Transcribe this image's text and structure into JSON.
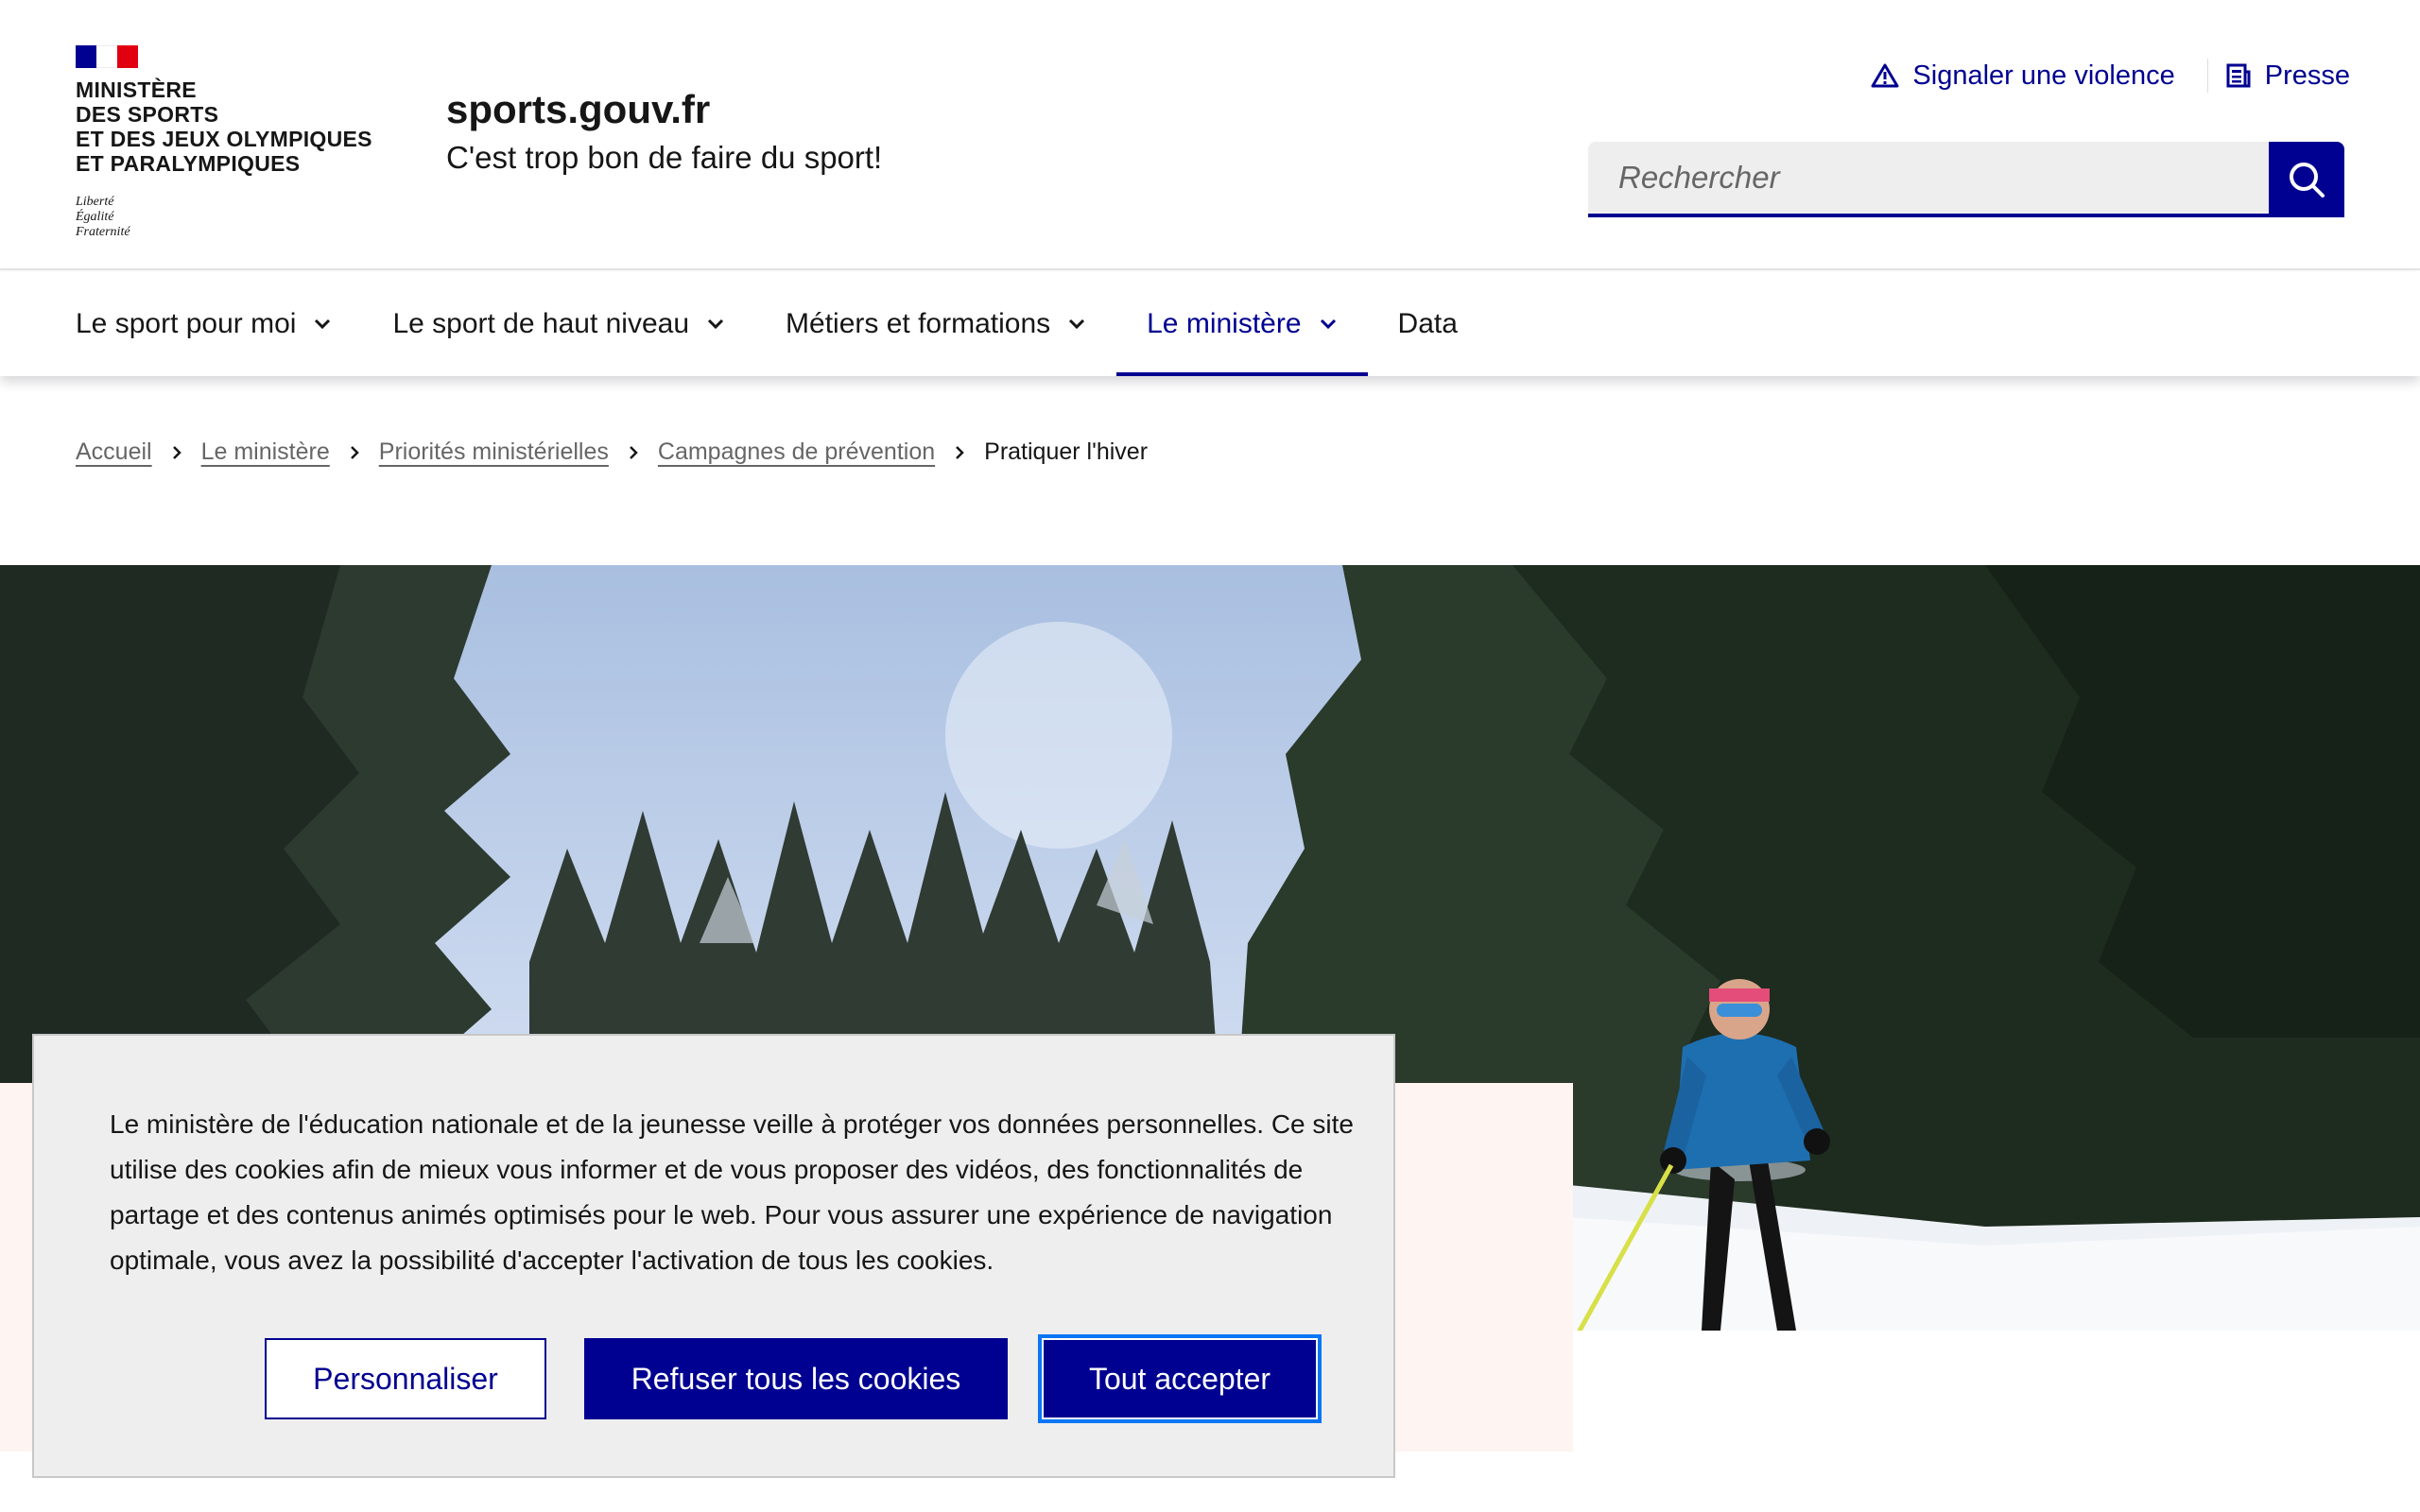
{
  "header": {
    "ministry_lines": [
      "Ministère",
      "des Sports",
      "et des Jeux Olympiques",
      "et Paralympiques"
    ],
    "motto_lines": [
      "Liberté",
      "Égalité",
      "Fraternité"
    ],
    "site_title": "sports.gouv.fr",
    "tagline": "C'est trop bon de faire du sport!",
    "tools": {
      "report_label": "Signaler une violence",
      "press_label": "Presse"
    },
    "search": {
      "placeholder": "Rechercher"
    }
  },
  "nav": {
    "items": [
      {
        "label": "Le sport pour moi"
      },
      {
        "label": "Le sport de haut niveau"
      },
      {
        "label": "Métiers et formations"
      },
      {
        "label": "Le ministère"
      },
      {
        "label": "Data"
      }
    ]
  },
  "breadcrumb": {
    "items": [
      "Accueil",
      "Le ministère",
      "Priorités ministérielles",
      "Campagnes de prévention"
    ],
    "current": "Pratiquer l'hiver"
  },
  "cookie": {
    "text": "Le ministère de l'éducation nationale et de la jeunesse veille à protéger vos données personnelles. Ce site utilise des cookies afin de mieux vous informer et de vous proposer des vidéos, des fonctionnalités de partage et des contenus animés optimisés pour le web. Pour vous assurer une expérience de navigation optimale, vous avez la possibilité d'accepter l'activation de tous les cookies.",
    "customize_label": "Personnaliser",
    "refuse_label": "Refuser tous les cookies",
    "accept_label": "Tout accepter"
  },
  "colors": {
    "primary": "#000091",
    "pink_panel": "#fef4f2",
    "cookie_bg": "#eeeeee",
    "focus_ring": "#0a76f6"
  }
}
